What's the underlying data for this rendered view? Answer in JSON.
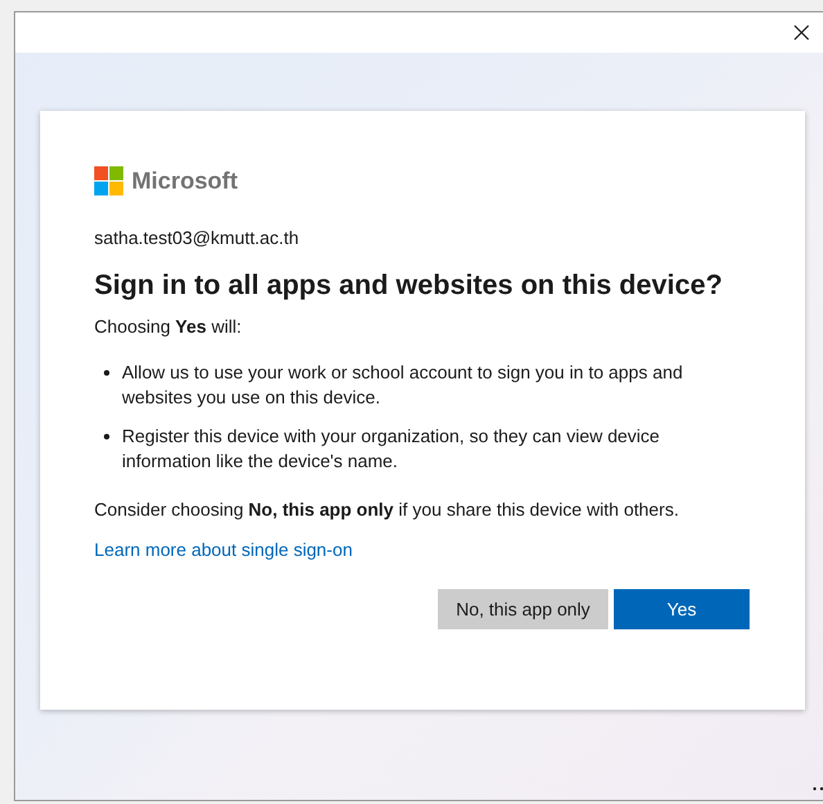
{
  "brand": {
    "name": "Microsoft"
  },
  "account": "satha.test03@kmutt.ac.th",
  "heading": "Sign in to all apps and websites on this device?",
  "intro": "Choosing **Yes** will:",
  "bullets": [
    "Allow us to use your work or school account to sign you in to apps and websites you use on this device.",
    "Register this device with your organization, so they can view device information like the device's name."
  ],
  "advice": "Consider choosing **No, this app only** if you share this device with others.",
  "link": "Learn more about single sign-on",
  "buttons": [
    {
      "label": "No, this app only",
      "kind": "secondary"
    },
    {
      "label": "Yes",
      "kind": "primary"
    }
  ]
}
